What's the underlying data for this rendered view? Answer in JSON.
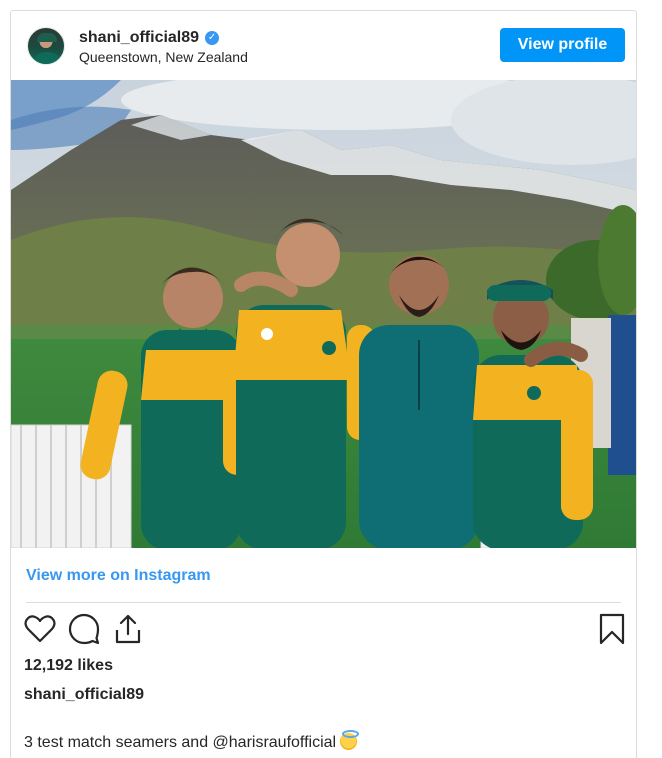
{
  "post": {
    "username": "shani_official89",
    "verified": true,
    "location": "Queenstown, New Zealand",
    "view_profile_label": "View profile",
    "view_more_label": "View more on Instagram",
    "likes": "12,192 likes",
    "caption_username": "shani_official89",
    "caption_text": "3 test match seamers and ",
    "caption_mention": "@harisraufofficial",
    "caption_emoji": "smiling-face-with-halo"
  },
  "icons": {
    "like": "heart-icon",
    "comment": "comment-icon",
    "share": "share-icon",
    "save": "bookmark-icon",
    "verified": "verified-badge-icon"
  },
  "colors": {
    "accent": "#0095f6",
    "link": "#3897f0",
    "text": "#262626",
    "border": "#dbdbdb",
    "kit_green": "#0f6a5a",
    "kit_yellow": "#f3b21f"
  }
}
